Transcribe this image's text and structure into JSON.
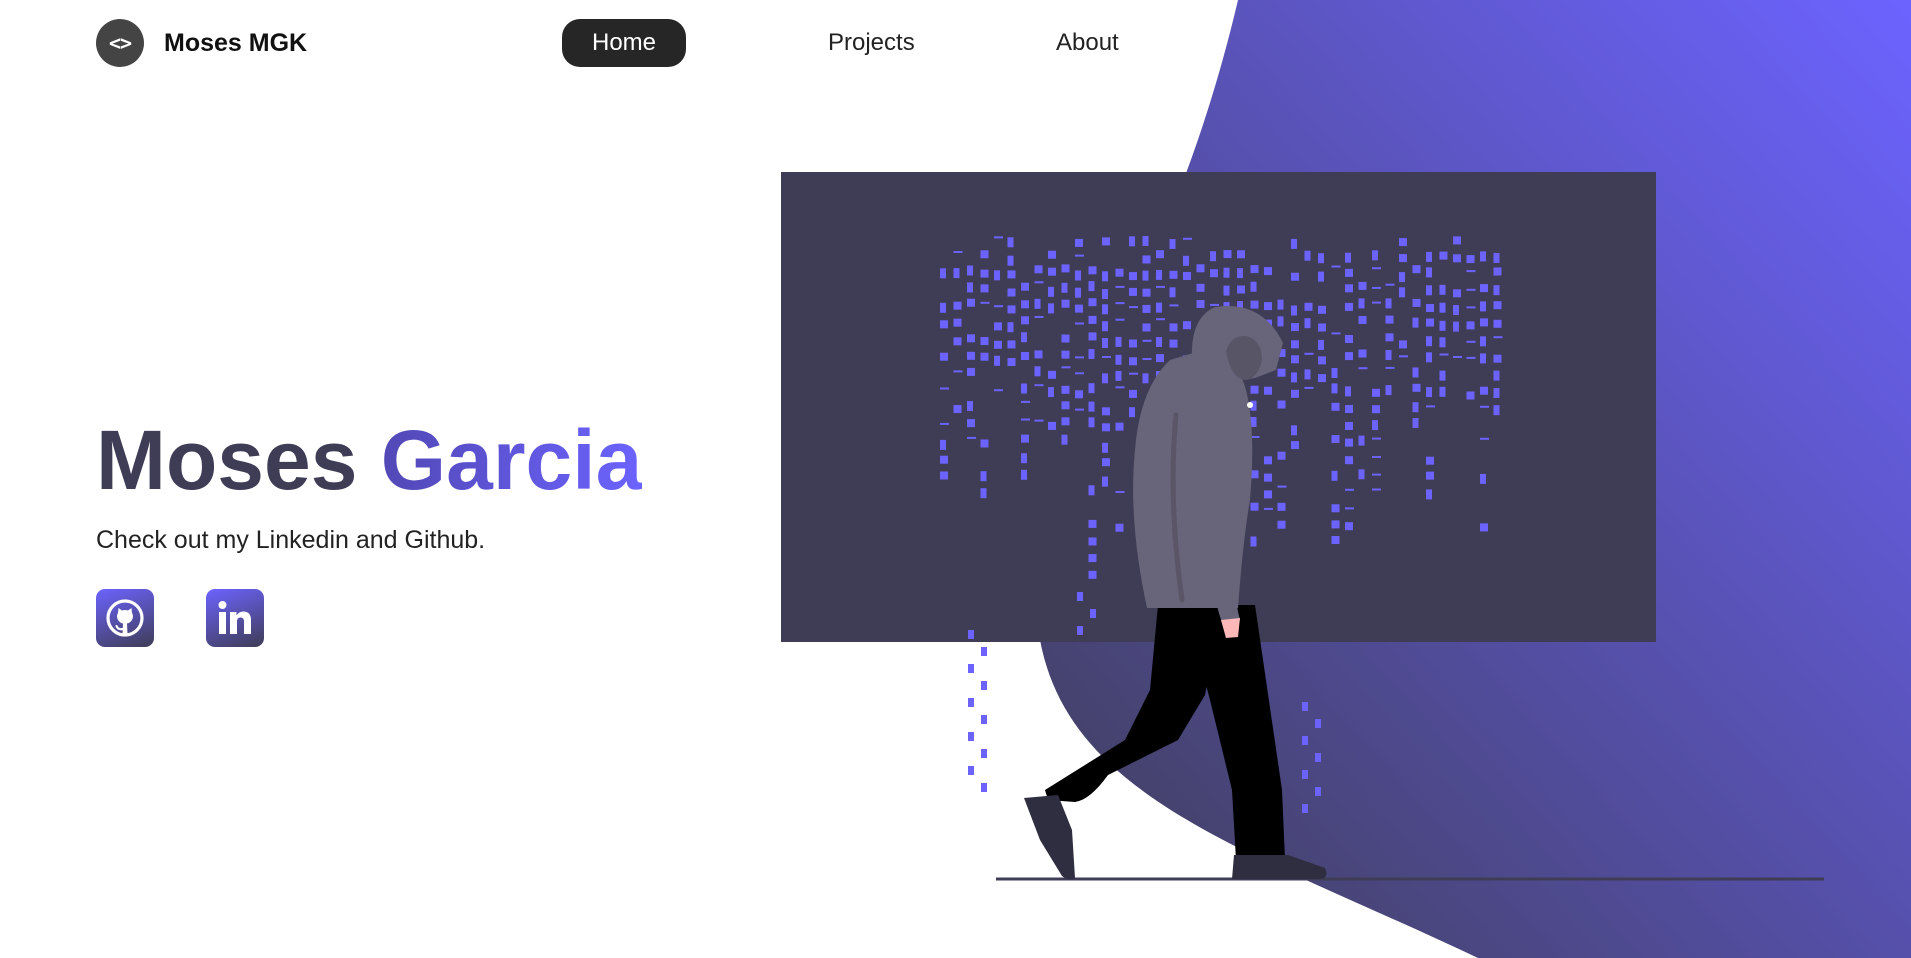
{
  "colors": {
    "accent": "#6c63ff",
    "dark_purple": "#3f3d56",
    "nav_active_bg": "#262626",
    "text": "#222222"
  },
  "nav": {
    "logo_icon": "code-brackets-icon",
    "logo_icon_text": "<>",
    "brand": "Moses MGK",
    "links": [
      {
        "label": "Home",
        "active": true
      },
      {
        "label": "Projects",
        "active": false
      },
      {
        "label": "About",
        "active": false
      }
    ]
  },
  "hero": {
    "first_name": "Moses",
    "last_name": "Garcia",
    "subtitle": "Check out my Linkedin and Github.",
    "socials": [
      {
        "icon": "github-icon"
      },
      {
        "icon": "linkedin-icon"
      }
    ]
  },
  "illustration": {
    "subject": "hacker-walking-illustration"
  }
}
